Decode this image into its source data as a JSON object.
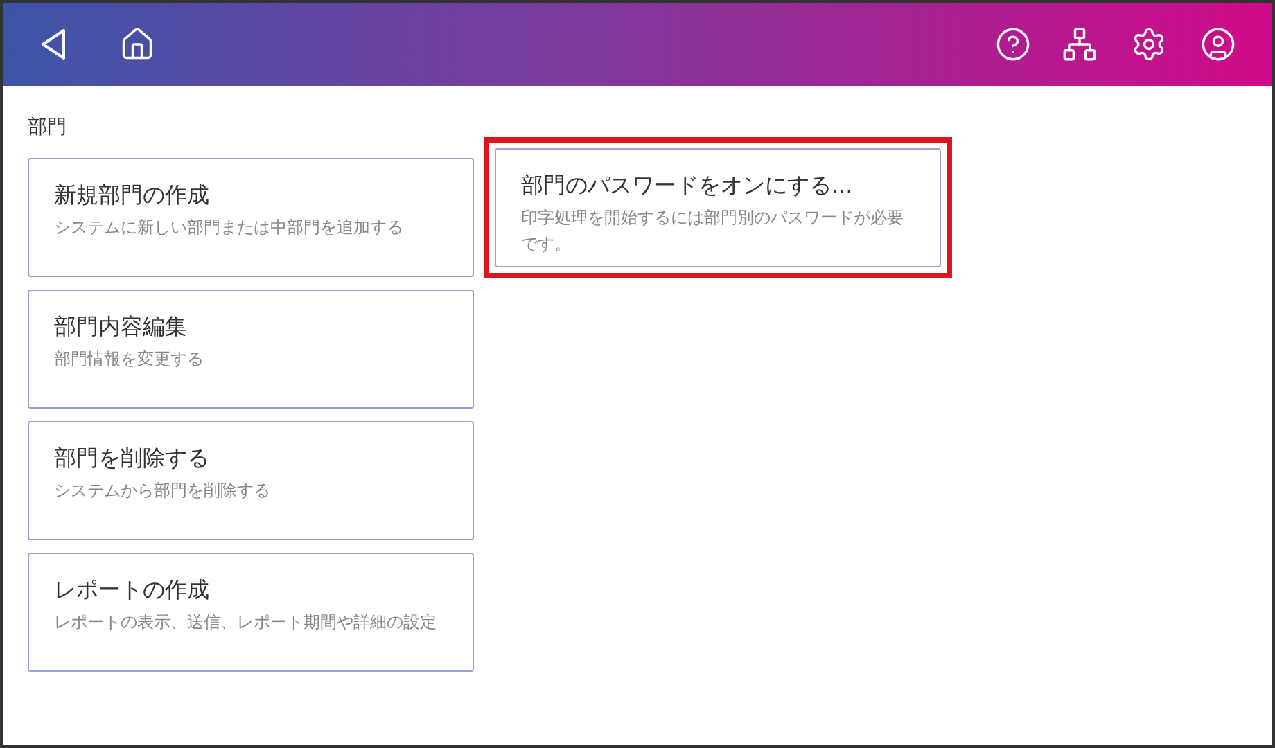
{
  "section_title": "部門",
  "left_cards": [
    {
      "title": "新規部門の作成",
      "description": "システムに新しい部門または中部門を追加する",
      "highlighted": false
    },
    {
      "title": "部門内容編集",
      "description": "部門情報を変更する",
      "highlighted": false
    },
    {
      "title": "部門を削除する",
      "description": "システムから部門を削除する",
      "highlighted": false
    },
    {
      "title": "レポートの作成",
      "description": "レポートの表示、送信、レポート期間や詳細の設定",
      "highlighted": false
    }
  ],
  "right_cards": [
    {
      "title": "部門のパスワードをオンにする...",
      "description": "印字処理を開始するには部門別のパスワードが必要です。",
      "highlighted": true
    }
  ]
}
